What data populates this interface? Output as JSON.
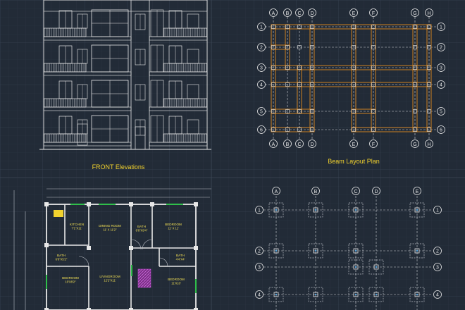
{
  "colors": {
    "background": "#222b37",
    "grid": "#2c3644",
    "grid_major": "#35404f",
    "line_white": "#e8e8e8",
    "line_grey": "#b8bcc4",
    "beam_orange": "#e08a1e",
    "dashed_grid": "#cfd3d8",
    "title_yellow": "#f2d22e",
    "room_text": "#f2e055",
    "green": "#2fbf4a",
    "magenta": "#b84cc8"
  },
  "titles": {
    "front": "FRONT Elevations",
    "beam": "Beam Layout Plan"
  },
  "beam_plan": {
    "col_labels": [
      "A",
      "B",
      "C",
      "D",
      "E",
      "F",
      "G",
      "H"
    ],
    "row_labels": [
      "1",
      "2",
      "3",
      "4",
      "5",
      "6"
    ]
  },
  "column_plan": {
    "col_labels": [
      "A",
      "B",
      "C",
      "D",
      "E"
    ],
    "row_labels": [
      "1",
      "2",
      "3",
      "4"
    ]
  },
  "floor_plan": {
    "rooms": [
      {
        "name": "KITCHEN",
        "dim": "7'1\"X11'"
      },
      {
        "name": "DINING ROOM",
        "dim": "11' X 11'2\""
      },
      {
        "name": "BATH",
        "dim": "6'6\"X9'4\""
      },
      {
        "name": "BEDROOM",
        "dim": "11' X 11'"
      },
      {
        "name": "BATH",
        "dim": "6'8\"X5'2\""
      },
      {
        "name": "BATH",
        "dim": "4'4\"X4'"
      },
      {
        "name": "LIVINGROOM",
        "dim": "12'2\"X11'"
      },
      {
        "name": "BEDROOM",
        "dim": "10'X8'2\""
      },
      {
        "name": "BEDROOM",
        "dim": "11'X10'"
      }
    ]
  }
}
